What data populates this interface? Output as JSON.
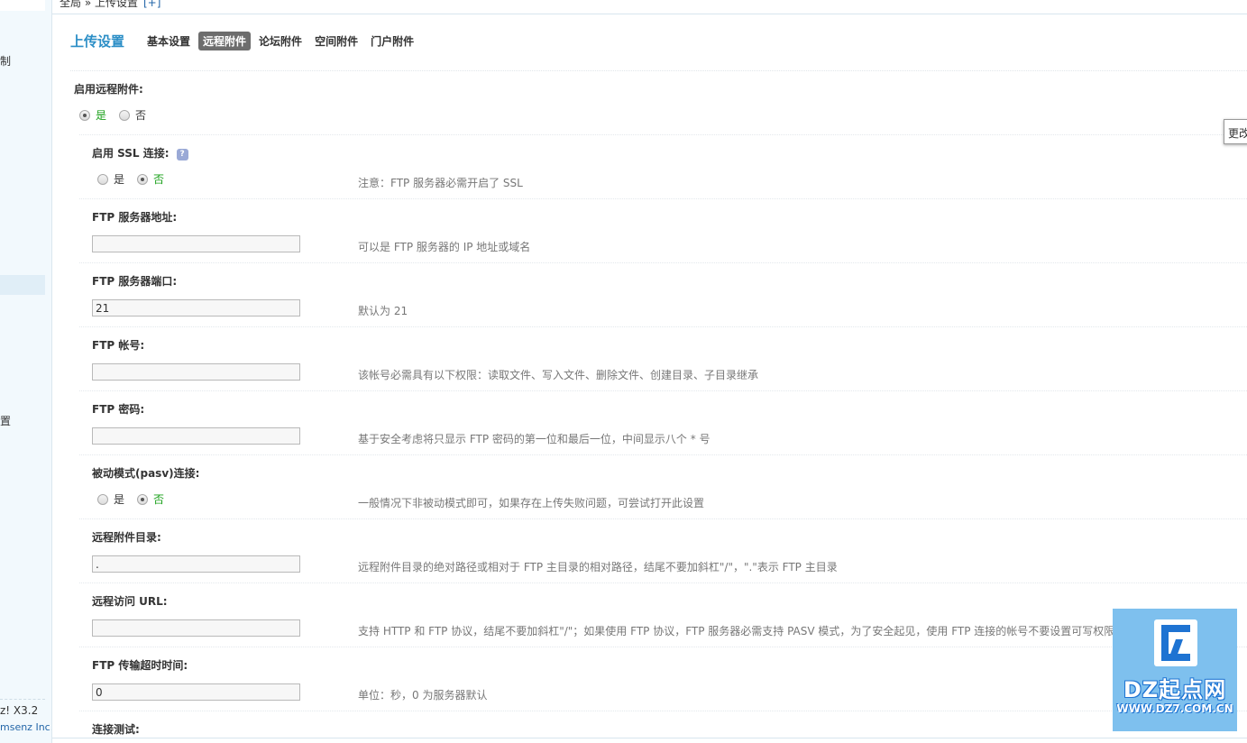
{
  "sidebar": {
    "texts": [
      "制",
      "置"
    ],
    "version": "z! X3.2",
    "copyright": "msenz Inc."
  },
  "breadcrumb": {
    "text": "全局 » 上传设置",
    "plus": "[+]"
  },
  "header": {
    "title": "上传设置",
    "tabs": [
      {
        "label": "基本设置",
        "active": false
      },
      {
        "label": "远程附件",
        "active": true
      },
      {
        "label": "论坛附件",
        "active": false
      },
      {
        "label": "空间附件",
        "active": false
      },
      {
        "label": "门户附件",
        "active": false
      }
    ]
  },
  "form": {
    "enable_remote": {
      "label": "启用远程附件:",
      "yes": "是",
      "no": "否",
      "selected": "yes"
    },
    "ssl": {
      "label": "启用 SSL 连接:",
      "yes": "是",
      "no": "否",
      "selected": "no",
      "tip": "注意：FTP 服务器必需开启了 SSL",
      "help": "?"
    },
    "ftp_host": {
      "label": "FTP 服务器地址:",
      "value": "",
      "tip": "可以是 FTP 服务器的 IP 地址或域名"
    },
    "ftp_port": {
      "label": "FTP 服务器端口:",
      "value": "21",
      "tip": "默认为 21"
    },
    "ftp_user": {
      "label": "FTP 帐号:",
      "value": "",
      "tip": "该帐号必需具有以下权限：读取文件、写入文件、删除文件、创建目录、子目录继承"
    },
    "ftp_pass": {
      "label": "FTP 密码:",
      "value": "",
      "tip": "基于安全考虑将只显示 FTP 密码的第一位和最后一位，中间显示八个 * 号"
    },
    "pasv": {
      "label": "被动模式(pasv)连接:",
      "yes": "是",
      "no": "否",
      "selected": "no",
      "tip": "一般情况下非被动模式即可，如果存在上传失败问题，可尝试打开此设置"
    },
    "remote_dir": {
      "label": "远程附件目录:",
      "value": ".",
      "tip": "远程附件目录的绝对路径或相对于 FTP 主目录的相对路径，结尾不要加斜杠\"/\"，\".\"表示 FTP 主目录"
    },
    "remote_url": {
      "label": "远程访问 URL:",
      "value": "",
      "tip": "支持 HTTP 和 FTP 协议，结尾不要加斜杠\"/\"；如果使用 FTP 协议，FTP 服务器必需支持 PASV 模式，为了安全起见，使用 FTP 连接的帐号不要设置可写权限和列表"
    },
    "timeout": {
      "label": "FTP 传输超时时间:",
      "value": "0",
      "tip": "单位：秒，0 为服务器默认"
    },
    "test": {
      "label": "连接测试:"
    }
  },
  "side_button": {
    "label": "更改"
  },
  "watermark": {
    "name": "DZ起点网",
    "url": "WWW.DZ7.COM.CN"
  }
}
